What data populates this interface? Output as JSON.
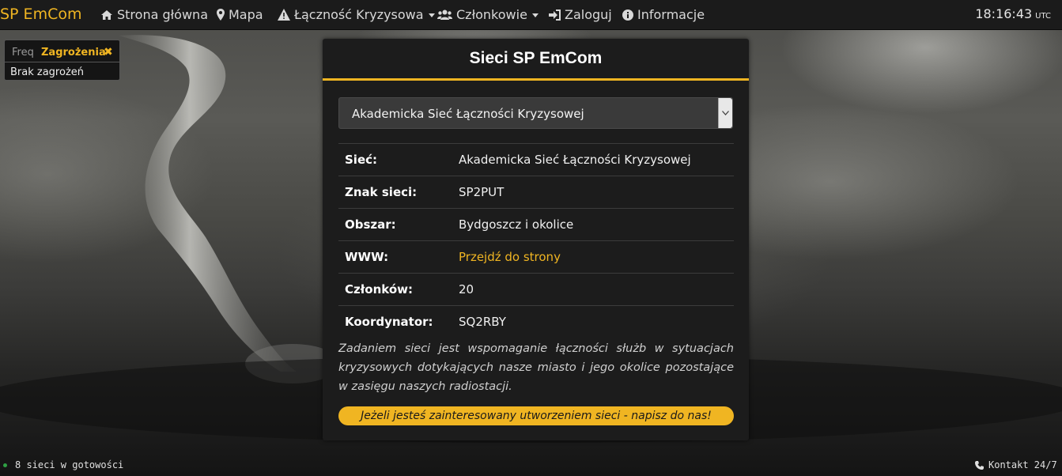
{
  "navbar": {
    "brand": "SP EmCom",
    "items": [
      {
        "label": "Strona główna",
        "icon": "home-icon"
      },
      {
        "label": "Mapa",
        "icon": "map-marker-icon"
      },
      {
        "label": "Łączność Kryzysowa",
        "icon": "warning-icon",
        "dropdown": true
      },
      {
        "label": "Członkowie",
        "icon": "users-icon",
        "dropdown": true
      },
      {
        "label": "Zaloguj",
        "icon": "sign-in-icon"
      },
      {
        "label": "Informacje",
        "icon": "info-icon"
      }
    ],
    "clock": {
      "time": "18:16:43",
      "zone": "UTC"
    }
  },
  "threats": {
    "tab_freq": "Freq",
    "tab_active": "Zagrożenia",
    "close": "✖",
    "message": "Brak zagrożeń"
  },
  "panel": {
    "title": "Sieci SP EmCom",
    "select": {
      "value": "Akademicka Sieć Łączności Kryzysowej"
    },
    "rows": [
      {
        "key": "Sieć:",
        "value": "Akademicka Sieć Łączności Kryzysowej"
      },
      {
        "key": "Znak sieci:",
        "value": "SP2PUT"
      },
      {
        "key": "Obszar:",
        "value": "Bydgoszcz i okolice"
      },
      {
        "key": "WWW:",
        "value": "Przejdź do strony"
      },
      {
        "key": "Członków:",
        "value": "20"
      },
      {
        "key": "Koordynator:",
        "value": "SQ2RBY"
      }
    ],
    "description": "Zadaniem sieci jest wspomaganie łączności służb w sytuacjach kryzysowych dotykających nasze miasto i jego okolice pozostające w zasięgu naszych radiostacji.",
    "cta": "Jeżeli jesteś zainteresowany utworzeniem sieci - napisz do nas!"
  },
  "footer": {
    "status": "8 sieci w gotowości",
    "contact": "Kontakt 24/7"
  },
  "colors": {
    "accent": "#f0b522",
    "navbar": "#1b1b1b",
    "panel": "#1c1c1c",
    "status_dot": "#2ea043"
  }
}
